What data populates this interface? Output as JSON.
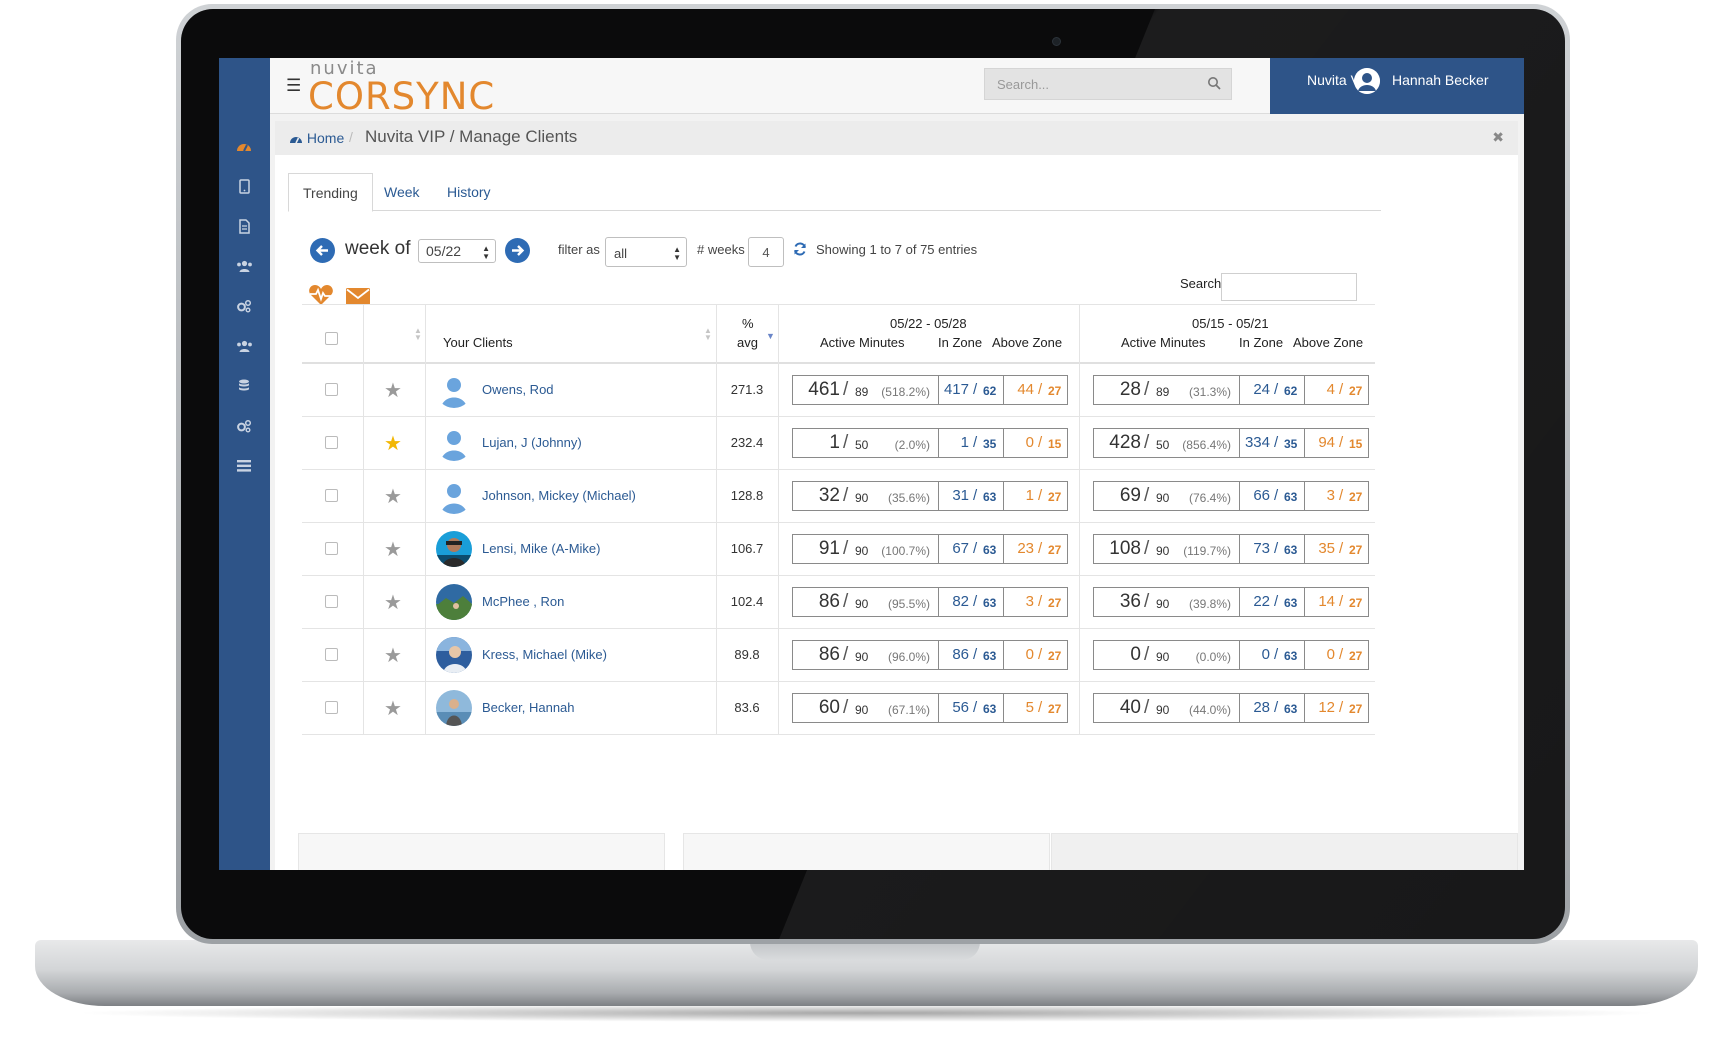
{
  "app": {
    "logo_small": "nuvita",
    "logo_big": "CORSYNC"
  },
  "topbar": {
    "search_placeholder": "Search...",
    "org": "Nuvita VIP",
    "user_name": "Hannah Becker"
  },
  "breadcrumb": {
    "home": "Home",
    "path": "Nuvita VIP / Manage Clients"
  },
  "tabs": [
    {
      "label": "Trending",
      "active": true
    },
    {
      "label": "Week",
      "active": false
    },
    {
      "label": "History",
      "active": false
    }
  ],
  "controls": {
    "week_of_label": "week of",
    "week_value": "05/22",
    "filter_label": "filter as",
    "filter_value": "all",
    "weeks_label": "# weeks",
    "weeks_value": "4",
    "showing": "Showing 1 to 7 of 75 entries",
    "search_label": "Search:"
  },
  "table": {
    "col_clients": "Your Clients",
    "col_pct": "%",
    "col_avg": "avg",
    "groups": [
      {
        "range": "05/22 - 05/28",
        "active_minutes": "Active Minutes",
        "in_zone": "In Zone",
        "above_zone": "Above Zone"
      },
      {
        "range": "05/15 - 05/21",
        "active_minutes": "Active Minutes",
        "in_zone": "In Zone",
        "above_zone": "Above Zone"
      }
    ],
    "rows": [
      {
        "name": "Owens, Rod",
        "starred": false,
        "avatar": "placeholder",
        "avg": "271.3",
        "w": [
          {
            "am": "461",
            "amt": "89",
            "pct": "(518.2%)",
            "iz": "417",
            "izt": "62",
            "az": "44",
            "azt": "27"
          },
          {
            "am": "28",
            "amt": "89",
            "pct": "(31.3%)",
            "iz": "24",
            "izt": "62",
            "az": "4",
            "azt": "27"
          }
        ]
      },
      {
        "name": "Lujan, J (Johnny)",
        "starred": true,
        "avatar": "placeholder",
        "avg": "232.4",
        "w": [
          {
            "am": "1",
            "amt": "50",
            "pct": "(2.0%)",
            "iz": "1",
            "izt": "35",
            "az": "0",
            "azt": "15"
          },
          {
            "am": "428",
            "amt": "50",
            "pct": "(856.4%)",
            "iz": "334",
            "izt": "35",
            "az": "94",
            "azt": "15"
          }
        ]
      },
      {
        "name": "Johnson, Mickey (Michael)",
        "starred": false,
        "avatar": "placeholder",
        "avg": "128.8",
        "w": [
          {
            "am": "32",
            "amt": "90",
            "pct": "(35.6%)",
            "iz": "31",
            "izt": "63",
            "az": "1",
            "azt": "27"
          },
          {
            "am": "69",
            "amt": "90",
            "pct": "(76.4%)",
            "iz": "66",
            "izt": "63",
            "az": "3",
            "azt": "27"
          }
        ]
      },
      {
        "name": "Lensi, Mike (A-Mike)",
        "starred": false,
        "avatar": "photo-a",
        "avg": "106.7",
        "w": [
          {
            "am": "91",
            "amt": "90",
            "pct": "(100.7%)",
            "iz": "67",
            "izt": "63",
            "az": "23",
            "azt": "27"
          },
          {
            "am": "108",
            "amt": "90",
            "pct": "(119.7%)",
            "iz": "73",
            "izt": "63",
            "az": "35",
            "azt": "27"
          }
        ]
      },
      {
        "name": "McPhee , Ron",
        "starred": false,
        "avatar": "photo-b",
        "avg": "102.4",
        "w": [
          {
            "am": "86",
            "amt": "90",
            "pct": "(95.5%)",
            "iz": "82",
            "izt": "63",
            "az": "3",
            "azt": "27"
          },
          {
            "am": "36",
            "amt": "90",
            "pct": "(39.8%)",
            "iz": "22",
            "izt": "63",
            "az": "14",
            "azt": "27"
          }
        ]
      },
      {
        "name": "Kress, Michael (Mike)",
        "starred": false,
        "avatar": "photo-c",
        "avg": "89.8",
        "w": [
          {
            "am": "86",
            "amt": "90",
            "pct": "(96.0%)",
            "iz": "86",
            "izt": "63",
            "az": "0",
            "azt": "27"
          },
          {
            "am": "0",
            "amt": "90",
            "pct": "(0.0%)",
            "iz": "0",
            "izt": "63",
            "az": "0",
            "azt": "27"
          }
        ]
      },
      {
        "name": "Becker, Hannah",
        "starred": false,
        "avatar": "photo-d",
        "avg": "83.6",
        "w": [
          {
            "am": "60",
            "amt": "90",
            "pct": "(67.1%)",
            "iz": "56",
            "izt": "63",
            "az": "5",
            "azt": "27"
          },
          {
            "am": "40",
            "amt": "90",
            "pct": "(44.0%)",
            "iz": "28",
            "izt": "63",
            "az": "12",
            "azt": "27"
          }
        ]
      }
    ]
  },
  "colors": {
    "sidebar": "#2e5488",
    "accent_orange": "#e3882e",
    "link_blue": "#2b5a93",
    "star_active": "#f2b705",
    "star_inactive": "#9a9a9a"
  },
  "icons": [
    "menu-icon",
    "search-icon",
    "user-icon",
    "home-icon",
    "close-icon",
    "arrow-left-icon",
    "arrow-right-icon",
    "refresh-icon",
    "heartbeat-icon",
    "envelope-icon",
    "star-icon"
  ]
}
